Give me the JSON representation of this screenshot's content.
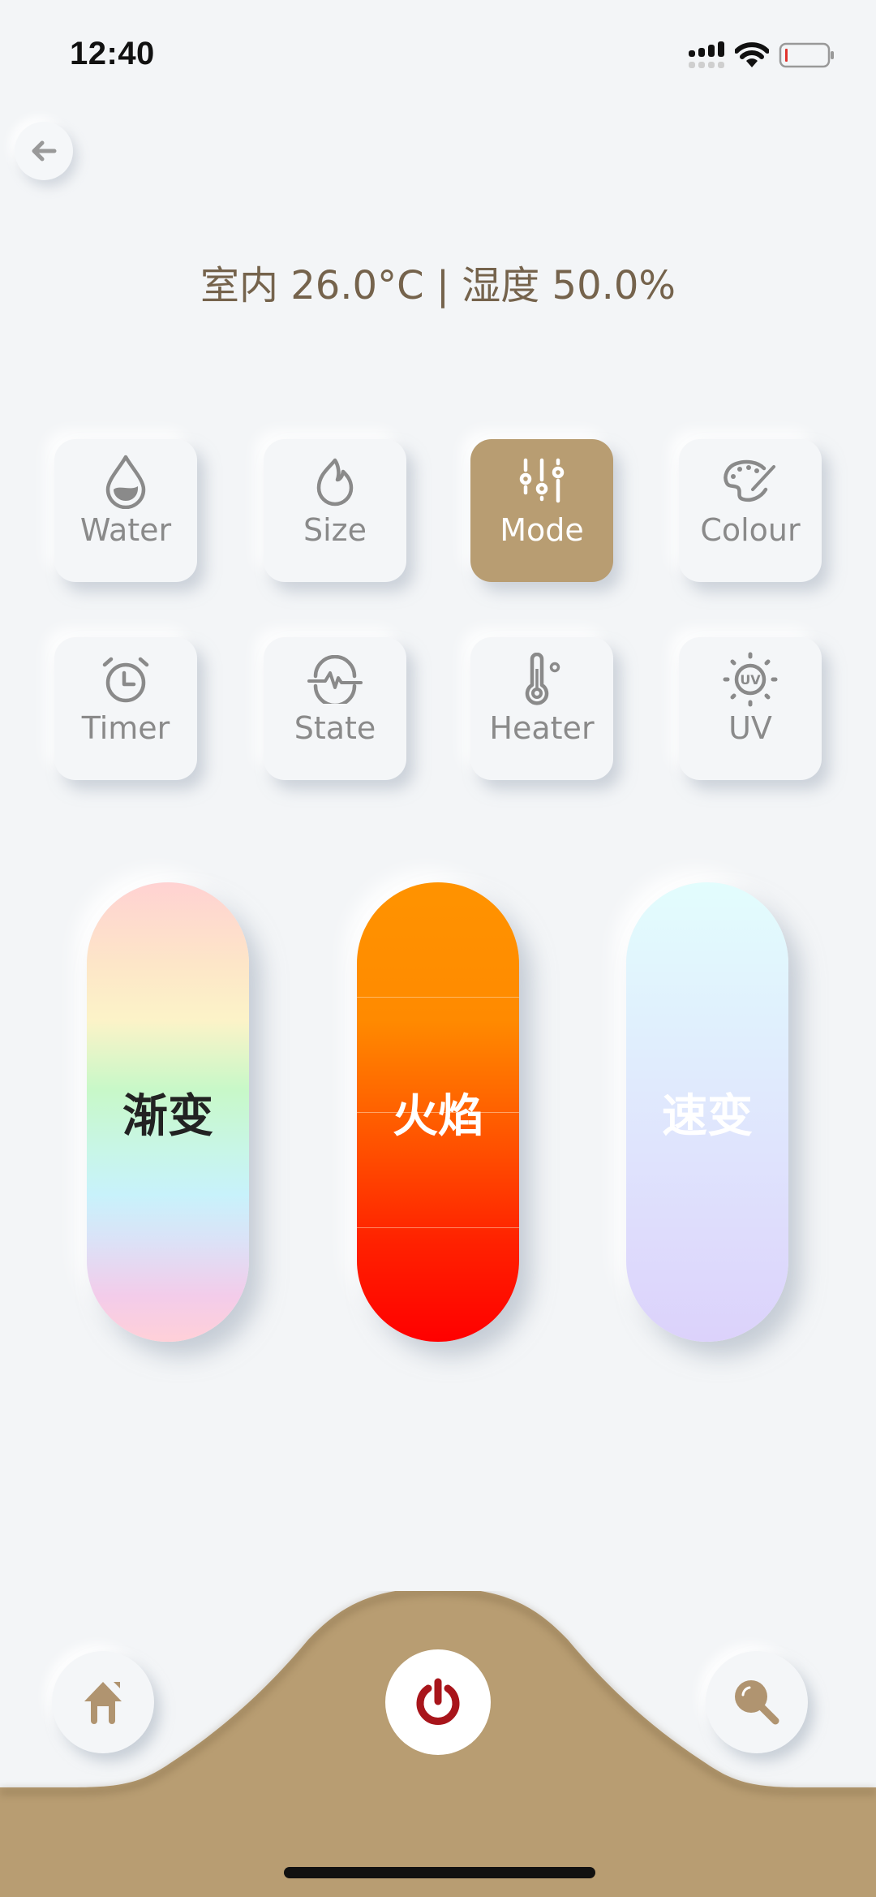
{
  "status_bar": {
    "time": "12:40",
    "icons": [
      "cellular-signal-icon",
      "wifi-icon",
      "battery-low-icon"
    ]
  },
  "header": {
    "back_icon": "arrow-left-icon",
    "climate_text": "室内 26.0°C | 湿度 50.0%"
  },
  "function_tiles": [
    {
      "id": "water",
      "label": "Water",
      "icon": "water-drop-icon",
      "active": false
    },
    {
      "id": "size",
      "label": "Size",
      "icon": "flame-icon",
      "active": false
    },
    {
      "id": "mode",
      "label": "Mode",
      "icon": "sliders-icon",
      "active": true
    },
    {
      "id": "colour",
      "label": "Colour",
      "icon": "palette-icon",
      "active": false
    },
    {
      "id": "timer",
      "label": "Timer",
      "icon": "alarm-clock-icon",
      "active": false
    },
    {
      "id": "state",
      "label": "State",
      "icon": "pulse-icon",
      "active": false
    },
    {
      "id": "heater",
      "label": "Heater",
      "icon": "thermometer-icon",
      "active": false
    },
    {
      "id": "uv",
      "label": "UV",
      "icon": "uv-sun-icon",
      "active": false
    }
  ],
  "modes": [
    {
      "id": "gradual",
      "label": "渐变"
    },
    {
      "id": "flame",
      "label": "火焰"
    },
    {
      "id": "fast",
      "label": "速变"
    }
  ],
  "bottom_nav": {
    "home_icon": "home-icon",
    "power_icon": "power-icon",
    "search_icon": "search-icon"
  },
  "colors": {
    "accent": "#b89d72",
    "text_brown": "#75634c",
    "icon_grey": "#8a8a8a",
    "power_red": "#a8151b",
    "background": "#f3f5f7"
  }
}
